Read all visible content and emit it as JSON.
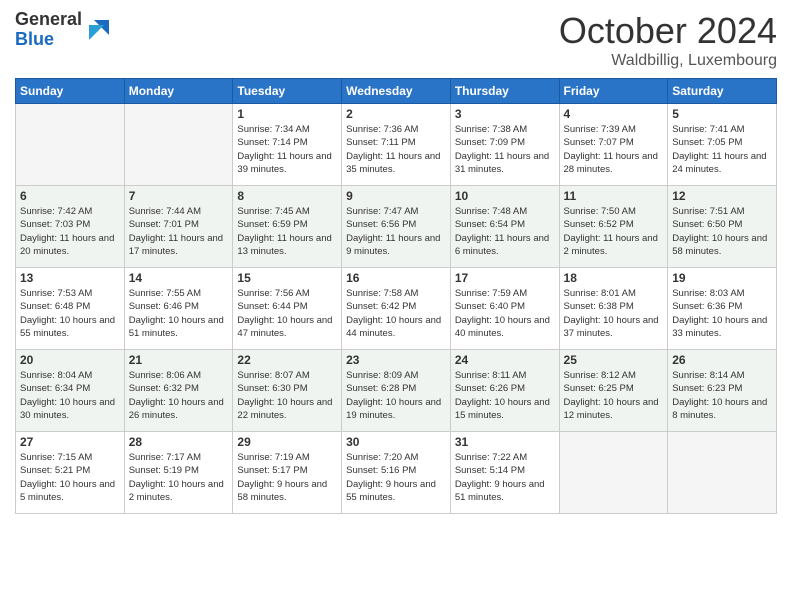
{
  "header": {
    "logo_general": "General",
    "logo_blue": "Blue",
    "month_title": "October 2024",
    "subtitle": "Waldbillig, Luxembourg"
  },
  "days_of_week": [
    "Sunday",
    "Monday",
    "Tuesday",
    "Wednesday",
    "Thursday",
    "Friday",
    "Saturday"
  ],
  "weeks": [
    {
      "shaded": false,
      "days": [
        {
          "num": "",
          "sunrise": "",
          "sunset": "",
          "daylight": ""
        },
        {
          "num": "",
          "sunrise": "",
          "sunset": "",
          "daylight": ""
        },
        {
          "num": "1",
          "sunrise": "Sunrise: 7:34 AM",
          "sunset": "Sunset: 7:14 PM",
          "daylight": "Daylight: 11 hours and 39 minutes."
        },
        {
          "num": "2",
          "sunrise": "Sunrise: 7:36 AM",
          "sunset": "Sunset: 7:11 PM",
          "daylight": "Daylight: 11 hours and 35 minutes."
        },
        {
          "num": "3",
          "sunrise": "Sunrise: 7:38 AM",
          "sunset": "Sunset: 7:09 PM",
          "daylight": "Daylight: 11 hours and 31 minutes."
        },
        {
          "num": "4",
          "sunrise": "Sunrise: 7:39 AM",
          "sunset": "Sunset: 7:07 PM",
          "daylight": "Daylight: 11 hours and 28 minutes."
        },
        {
          "num": "5",
          "sunrise": "Sunrise: 7:41 AM",
          "sunset": "Sunset: 7:05 PM",
          "daylight": "Daylight: 11 hours and 24 minutes."
        }
      ]
    },
    {
      "shaded": true,
      "days": [
        {
          "num": "6",
          "sunrise": "Sunrise: 7:42 AM",
          "sunset": "Sunset: 7:03 PM",
          "daylight": "Daylight: 11 hours and 20 minutes."
        },
        {
          "num": "7",
          "sunrise": "Sunrise: 7:44 AM",
          "sunset": "Sunset: 7:01 PM",
          "daylight": "Daylight: 11 hours and 17 minutes."
        },
        {
          "num": "8",
          "sunrise": "Sunrise: 7:45 AM",
          "sunset": "Sunset: 6:59 PM",
          "daylight": "Daylight: 11 hours and 13 minutes."
        },
        {
          "num": "9",
          "sunrise": "Sunrise: 7:47 AM",
          "sunset": "Sunset: 6:56 PM",
          "daylight": "Daylight: 11 hours and 9 minutes."
        },
        {
          "num": "10",
          "sunrise": "Sunrise: 7:48 AM",
          "sunset": "Sunset: 6:54 PM",
          "daylight": "Daylight: 11 hours and 6 minutes."
        },
        {
          "num": "11",
          "sunrise": "Sunrise: 7:50 AM",
          "sunset": "Sunset: 6:52 PM",
          "daylight": "Daylight: 11 hours and 2 minutes."
        },
        {
          "num": "12",
          "sunrise": "Sunrise: 7:51 AM",
          "sunset": "Sunset: 6:50 PM",
          "daylight": "Daylight: 10 hours and 58 minutes."
        }
      ]
    },
    {
      "shaded": false,
      "days": [
        {
          "num": "13",
          "sunrise": "Sunrise: 7:53 AM",
          "sunset": "Sunset: 6:48 PM",
          "daylight": "Daylight: 10 hours and 55 minutes."
        },
        {
          "num": "14",
          "sunrise": "Sunrise: 7:55 AM",
          "sunset": "Sunset: 6:46 PM",
          "daylight": "Daylight: 10 hours and 51 minutes."
        },
        {
          "num": "15",
          "sunrise": "Sunrise: 7:56 AM",
          "sunset": "Sunset: 6:44 PM",
          "daylight": "Daylight: 10 hours and 47 minutes."
        },
        {
          "num": "16",
          "sunrise": "Sunrise: 7:58 AM",
          "sunset": "Sunset: 6:42 PM",
          "daylight": "Daylight: 10 hours and 44 minutes."
        },
        {
          "num": "17",
          "sunrise": "Sunrise: 7:59 AM",
          "sunset": "Sunset: 6:40 PM",
          "daylight": "Daylight: 10 hours and 40 minutes."
        },
        {
          "num": "18",
          "sunrise": "Sunrise: 8:01 AM",
          "sunset": "Sunset: 6:38 PM",
          "daylight": "Daylight: 10 hours and 37 minutes."
        },
        {
          "num": "19",
          "sunrise": "Sunrise: 8:03 AM",
          "sunset": "Sunset: 6:36 PM",
          "daylight": "Daylight: 10 hours and 33 minutes."
        }
      ]
    },
    {
      "shaded": true,
      "days": [
        {
          "num": "20",
          "sunrise": "Sunrise: 8:04 AM",
          "sunset": "Sunset: 6:34 PM",
          "daylight": "Daylight: 10 hours and 30 minutes."
        },
        {
          "num": "21",
          "sunrise": "Sunrise: 8:06 AM",
          "sunset": "Sunset: 6:32 PM",
          "daylight": "Daylight: 10 hours and 26 minutes."
        },
        {
          "num": "22",
          "sunrise": "Sunrise: 8:07 AM",
          "sunset": "Sunset: 6:30 PM",
          "daylight": "Daylight: 10 hours and 22 minutes."
        },
        {
          "num": "23",
          "sunrise": "Sunrise: 8:09 AM",
          "sunset": "Sunset: 6:28 PM",
          "daylight": "Daylight: 10 hours and 19 minutes."
        },
        {
          "num": "24",
          "sunrise": "Sunrise: 8:11 AM",
          "sunset": "Sunset: 6:26 PM",
          "daylight": "Daylight: 10 hours and 15 minutes."
        },
        {
          "num": "25",
          "sunrise": "Sunrise: 8:12 AM",
          "sunset": "Sunset: 6:25 PM",
          "daylight": "Daylight: 10 hours and 12 minutes."
        },
        {
          "num": "26",
          "sunrise": "Sunrise: 8:14 AM",
          "sunset": "Sunset: 6:23 PM",
          "daylight": "Daylight: 10 hours and 8 minutes."
        }
      ]
    },
    {
      "shaded": false,
      "days": [
        {
          "num": "27",
          "sunrise": "Sunrise: 7:15 AM",
          "sunset": "Sunset: 5:21 PM",
          "daylight": "Daylight: 10 hours and 5 minutes."
        },
        {
          "num": "28",
          "sunrise": "Sunrise: 7:17 AM",
          "sunset": "Sunset: 5:19 PM",
          "daylight": "Daylight: 10 hours and 2 minutes."
        },
        {
          "num": "29",
          "sunrise": "Sunrise: 7:19 AM",
          "sunset": "Sunset: 5:17 PM",
          "daylight": "Daylight: 9 hours and 58 minutes."
        },
        {
          "num": "30",
          "sunrise": "Sunrise: 7:20 AM",
          "sunset": "Sunset: 5:16 PM",
          "daylight": "Daylight: 9 hours and 55 minutes."
        },
        {
          "num": "31",
          "sunrise": "Sunrise: 7:22 AM",
          "sunset": "Sunset: 5:14 PM",
          "daylight": "Daylight: 9 hours and 51 minutes."
        },
        {
          "num": "",
          "sunrise": "",
          "sunset": "",
          "daylight": ""
        },
        {
          "num": "",
          "sunrise": "",
          "sunset": "",
          "daylight": ""
        }
      ]
    }
  ]
}
